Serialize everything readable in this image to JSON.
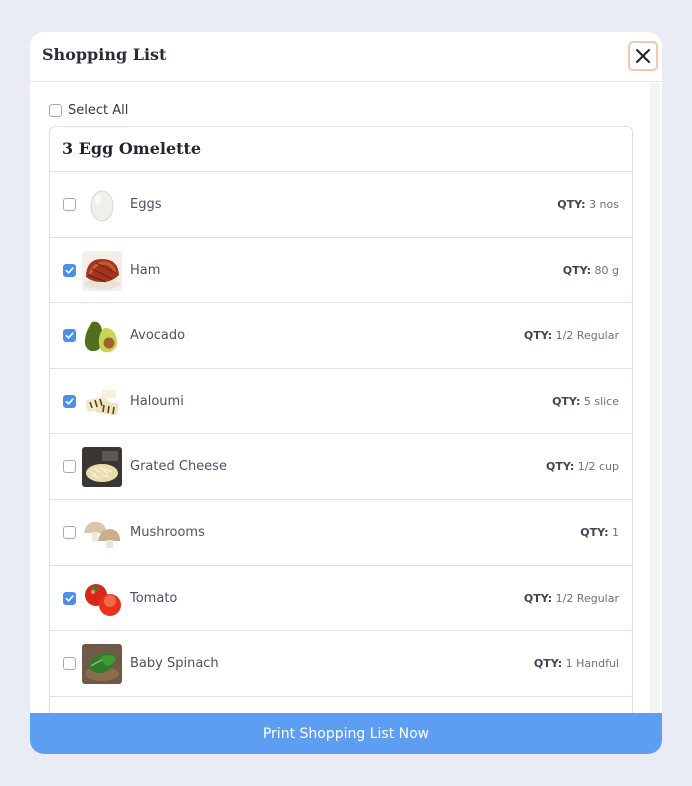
{
  "modal": {
    "title": "Shopping List",
    "close_icon": "close-icon"
  },
  "select_all": {
    "label": "Select All",
    "checked": false
  },
  "recipe": {
    "title": "3 Egg Omelette",
    "items": [
      {
        "name": "Eggs",
        "qty_label": "QTY:",
        "qty": "3 nos",
        "checked": false,
        "icon": "egg-icon"
      },
      {
        "name": "Ham",
        "qty_label": "QTY:",
        "qty": "80 g",
        "checked": true,
        "icon": "ham-icon"
      },
      {
        "name": "Avocado",
        "qty_label": "QTY:",
        "qty": "1/2 Regular",
        "checked": true,
        "icon": "avocado-icon"
      },
      {
        "name": "Haloumi",
        "qty_label": "QTY:",
        "qty": "5 slice",
        "checked": true,
        "icon": "haloumi-icon"
      },
      {
        "name": "Grated Cheese",
        "qty_label": "QTY:",
        "qty": "1/2 cup",
        "checked": false,
        "icon": "grated-cheese-icon"
      },
      {
        "name": "Mushrooms",
        "qty_label": "QTY:",
        "qty": "1",
        "checked": false,
        "icon": "mushroom-icon"
      },
      {
        "name": "Tomato",
        "qty_label": "QTY:",
        "qty": "1/2 Regular",
        "checked": true,
        "icon": "tomato-icon"
      },
      {
        "name": "Baby Spinach",
        "qty_label": "QTY:",
        "qty": "1 Handful",
        "checked": false,
        "icon": "spinach-icon"
      }
    ]
  },
  "footer": {
    "button_label": "Print Shopping List Now"
  },
  "colors": {
    "accent": "#5d9ef3",
    "checkbox_checked": "#4d8fe8",
    "background": "#e9ebf5"
  }
}
